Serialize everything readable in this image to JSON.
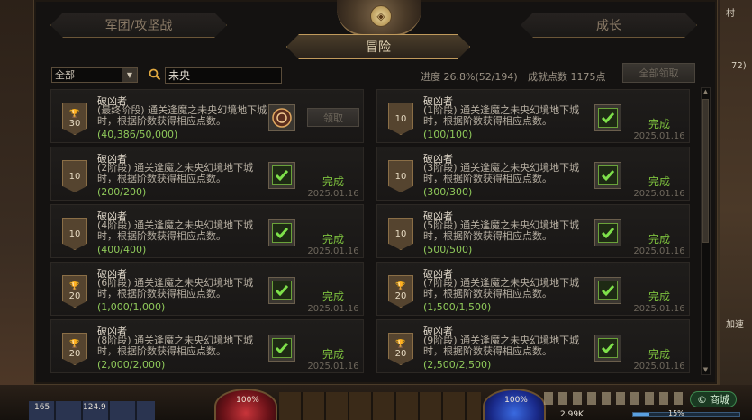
{
  "tabs": {
    "left": "军团/攻坚战",
    "right": "成长",
    "center": "冒险"
  },
  "filter": {
    "selected": "全部"
  },
  "search": {
    "value": "未央"
  },
  "summary": {
    "progress": "进度 26.8%(52/194)",
    "points": "成就点数 1175点",
    "claim_all": "全部领取"
  },
  "achievements": [
    {
      "title": "破凶者",
      "desc": "(最终阶段) 通关逢魔之未央幻境地下城时，根据阶数获得相应点数。",
      "progress": "(40,386/50,000)",
      "points": "30",
      "completed": false,
      "action": "领取",
      "date": ""
    },
    {
      "title": "破凶者",
      "desc": "(1阶段) 通关逢魔之未央幻境地下城时，根据阶数获得相应点数。",
      "progress": "(100/100)",
      "points": "10",
      "completed": true,
      "action": "完成",
      "date": "2025.01.16"
    },
    {
      "title": "破凶者",
      "desc": "(2阶段) 通关逢魔之未央幻境地下城时，根据阶数获得相应点数。",
      "progress": "(200/200)",
      "points": "10",
      "completed": true,
      "action": "完成",
      "date": "2025.01.16"
    },
    {
      "title": "破凶者",
      "desc": "(3阶段) 通关逢魔之未央幻境地下城时，根据阶数获得相应点数。",
      "progress": "(300/300)",
      "points": "10",
      "completed": true,
      "action": "完成",
      "date": "2025.01.16"
    },
    {
      "title": "破凶者",
      "desc": "(4阶段) 通关逢魔之未央幻境地下城时，根据阶数获得相应点数。",
      "progress": "(400/400)",
      "points": "10",
      "completed": true,
      "action": "完成",
      "date": "2025.01.16"
    },
    {
      "title": "破凶者",
      "desc": "(5阶段) 通关逢魔之未央幻境地下城时，根据阶数获得相应点数。",
      "progress": "(500/500)",
      "points": "10",
      "completed": true,
      "action": "完成",
      "date": "2025.01.16"
    },
    {
      "title": "破凶者",
      "desc": "(6阶段) 通关逢魔之未央幻境地下城时，根据阶数获得相应点数。",
      "progress": "(1,000/1,000)",
      "points": "20",
      "completed": true,
      "action": "完成",
      "date": "2025.01.16"
    },
    {
      "title": "破凶者",
      "desc": "(7阶段) 通关逢魔之未央幻境地下城时，根据阶数获得相应点数。",
      "progress": "(1,500/1,500)",
      "points": "20",
      "completed": true,
      "action": "完成",
      "date": "2025.01.16"
    },
    {
      "title": "破凶者",
      "desc": "(8阶段) 通关逢魔之未央幻境地下城时，根据阶数获得相应点数。",
      "progress": "(2,000/2,000)",
      "points": "20",
      "completed": true,
      "action": "完成",
      "date": "2025.01.16"
    },
    {
      "title": "破凶者",
      "desc": "(9阶段) 通关逢魔之未央幻境地下城时，根据阶数获得相应点数。",
      "progress": "(2,500/2,500)",
      "points": "20",
      "completed": true,
      "action": "完成",
      "date": "2025.01.16"
    }
  ],
  "hud": {
    "hp": "100%",
    "mp": "100%",
    "level": "165",
    "fatigue": "124.9",
    "shop": "商城",
    "exp": "15%",
    "exp_level": 0.15,
    "side_right_top": "村",
    "side_right_mid": "72)",
    "side_right_speed": "加速",
    "side_right_gold": "2.99K"
  },
  "colors": {
    "complete": "#7ec23e",
    "progress": "#8fc95a",
    "accent": "#c09a5c"
  }
}
